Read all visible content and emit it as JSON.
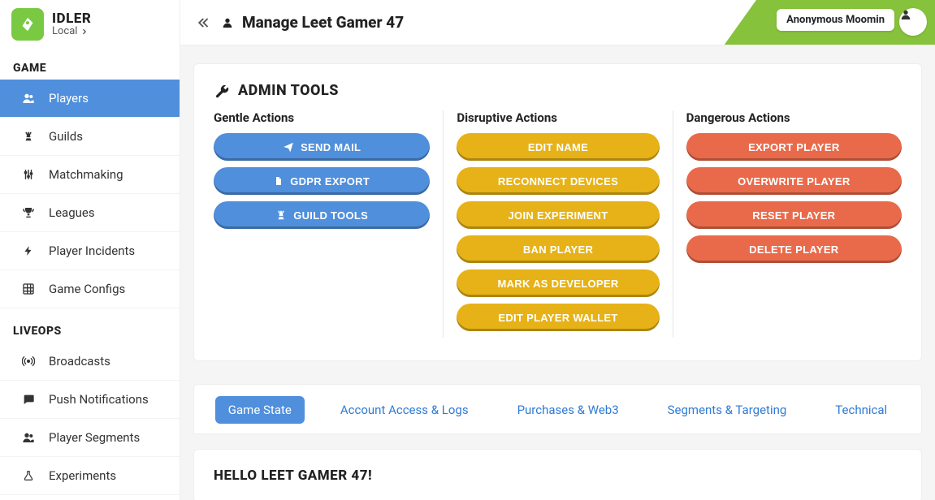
{
  "brand": {
    "name": "IDLER",
    "env": "Local"
  },
  "header": {
    "title": "Manage Leet Gamer 47",
    "user_name": "Anonymous Moomin"
  },
  "sidebar": {
    "sections": [
      {
        "label": "GAME",
        "items": [
          {
            "id": "players",
            "label": "Players",
            "icon": "users",
            "active": true
          },
          {
            "id": "guilds",
            "label": "Guilds",
            "icon": "chess",
            "active": false
          },
          {
            "id": "matchmaking",
            "label": "Matchmaking",
            "icon": "sliders",
            "active": false
          },
          {
            "id": "leagues",
            "label": "Leagues",
            "icon": "trophy",
            "active": false
          },
          {
            "id": "player-incidents",
            "label": "Player Incidents",
            "icon": "bolt",
            "active": false
          },
          {
            "id": "game-configs",
            "label": "Game Configs",
            "icon": "grid",
            "active": false
          }
        ]
      },
      {
        "label": "LIVEOPS",
        "items": [
          {
            "id": "broadcasts",
            "label": "Broadcasts",
            "icon": "broadcast",
            "active": false
          },
          {
            "id": "push-notifications",
            "label": "Push Notifications",
            "icon": "chat",
            "active": false
          },
          {
            "id": "player-segments",
            "label": "Player Segments",
            "icon": "users",
            "active": false
          },
          {
            "id": "experiments",
            "label": "Experiments",
            "icon": "flask",
            "active": false
          }
        ]
      }
    ]
  },
  "admin_tools": {
    "title": "ADMIN TOOLS",
    "gentle": {
      "label": "Gentle Actions",
      "buttons": [
        "SEND MAIL",
        "GDPR EXPORT",
        "GUILD TOOLS"
      ]
    },
    "disruptive": {
      "label": "Disruptive Actions",
      "buttons": [
        "EDIT NAME",
        "RECONNECT DEVICES",
        "JOIN EXPERIMENT",
        "BAN PLAYER",
        "MARK AS DEVELOPER",
        "EDIT PLAYER WALLET"
      ]
    },
    "dangerous": {
      "label": "Dangerous Actions",
      "buttons": [
        "EXPORT PLAYER",
        "OVERWRITE PLAYER",
        "RESET PLAYER",
        "DELETE PLAYER"
      ]
    }
  },
  "tabs": [
    {
      "id": "game-state",
      "label": "Game State",
      "active": true
    },
    {
      "id": "account",
      "label": "Account Access & Logs",
      "active": false
    },
    {
      "id": "purchases",
      "label": "Purchases & Web3",
      "active": false
    },
    {
      "id": "segments",
      "label": "Segments & Targeting",
      "active": false
    },
    {
      "id": "technical",
      "label": "Technical",
      "active": false
    }
  ],
  "hello": {
    "title": "HELLO LEET GAMER 47!"
  },
  "gentle_icons": [
    "plane",
    "file",
    "chess"
  ]
}
